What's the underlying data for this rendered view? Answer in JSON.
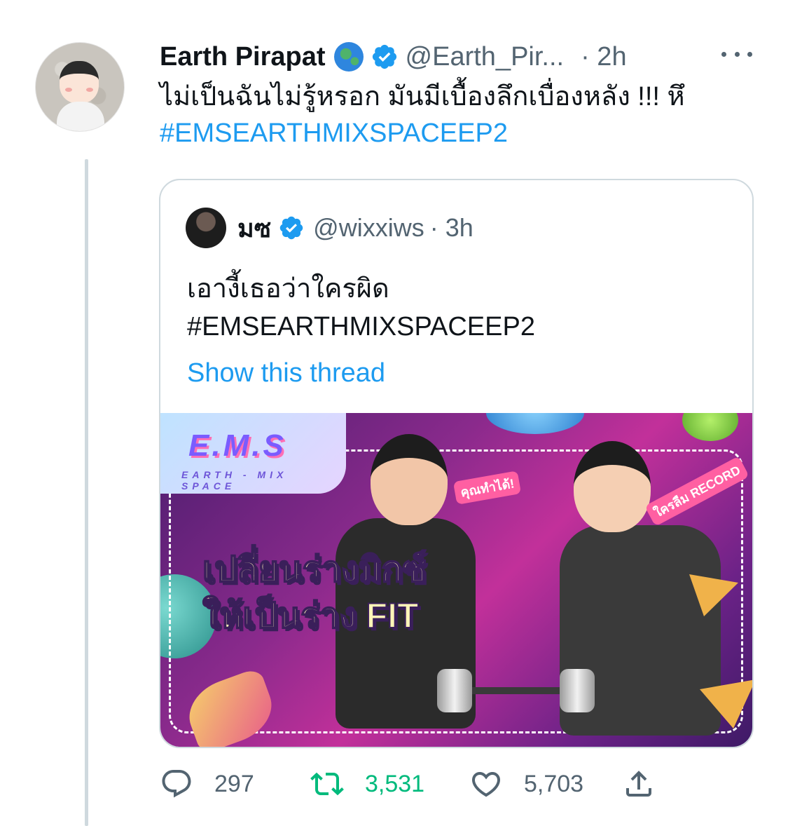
{
  "tweet": {
    "author_name": "Earth Pirapat",
    "author_handle": "@Earth_Pir...",
    "time": "· 2h",
    "text_line1": "ไม่เป็นฉันไม่รู้หรอก มันมีเบื้องลึกเบื่องหลัง !!! หึ",
    "hashtag": "#EMSEARTHMIXSPACEEP2",
    "icons": [
      "globe-icon",
      "verified-icon",
      "more-icon"
    ]
  },
  "quoted_tweet": {
    "author_name": "มซ",
    "author_handle": "@wixxiws",
    "time": "· 3h",
    "text_line1": "เอางี้เธอว่าใครผิด",
    "text_line2": "#EMSEARTHMIXSPACEEP2",
    "show_thread": "Show this thread",
    "media": {
      "logo": "E.M.S",
      "logo_sub": "EARTH - MIX SPACE",
      "caption_line1": "เปลี่ยนร่างมิกซ์",
      "caption_line2": "ให้เป็นร่าง FIT",
      "tag1": "คุณทำได้!",
      "tag2": "ใครลืม RECORD"
    }
  },
  "actions": {
    "replies": "297",
    "retweets": "3,531",
    "likes": "5,703"
  },
  "colors": {
    "link_blue": "#1d9bf0",
    "secondary_text": "#536471",
    "retweet_green": "#00ba7c",
    "border": "#cfd9de"
  }
}
